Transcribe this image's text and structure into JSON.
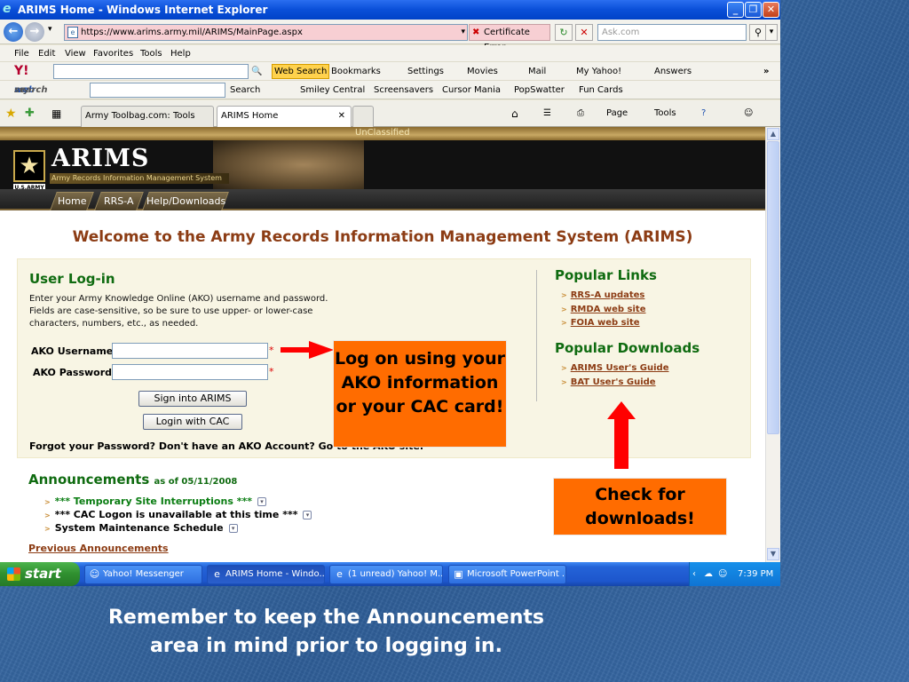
{
  "window": {
    "title": "ARIMS Home - Windows Internet Explorer",
    "address": "https://www.arims.army.mil/ARIMS/MainPage.aspx",
    "cert_error": "Certificate Error",
    "search_placeholder": "Ask.com"
  },
  "menu": [
    "File",
    "Edit",
    "View",
    "Favorites",
    "Tools",
    "Help"
  ],
  "yahoo_toolbar": {
    "web_search": "Web Search",
    "bookmarks": "Bookmarks",
    "settings": "Settings",
    "movies": "Movies",
    "mail": "Mail",
    "my_yahoo": "My Yahoo!",
    "answers": "Answers",
    "more": "»"
  },
  "mws_toolbar": {
    "logo_my": "my",
    "logo_web": "web",
    "logo_search": "search",
    "search": "Search",
    "smiley": "Smiley Central",
    "screensavers": "Screensavers",
    "cursor": "Cursor Mania",
    "popswatter": "PopSwatter",
    "funcards": "Fun Cards"
  },
  "tabs": {
    "tab1": "Army Toolbag.com: Tools for...",
    "tab2": "ARIMS Home",
    "page": "Page",
    "tools": "Tools"
  },
  "banner": {
    "classification": "UnClassified",
    "logo": "ARIMS",
    "subtitle": "Army Records Information Management System",
    "usarmy": "U.S.ARMY",
    "nav": [
      "Home",
      "RRS-A",
      "Help/Downloads"
    ]
  },
  "page": {
    "welcome": "Welcome to the Army Records Information Management System (ARIMS)",
    "login_title": "User Log-in",
    "login_desc": "Enter your Army Knowledge Online (AKO) username and password. Fields are case-sensitive, so be sure to use upper- or lower-case characters, numbers, etc., as needed.",
    "username_label": "AKO Username:",
    "password_label": "AKO Password:",
    "required_mark": "*",
    "sign_in": "Sign into ARIMS",
    "cac_login": "Login with CAC",
    "forgot": "Forgot your Password? Don't have an AKO Account?  Go to the AKO site.",
    "popular_links_title": "Popular Links",
    "popular_links": [
      "RRS-A updates",
      "RMDA web site",
      "FOIA web site"
    ],
    "popular_downloads_title": "Popular Downloads",
    "popular_downloads": [
      "ARIMS User's Guide",
      "BAT User's Guide"
    ],
    "announcements_title": "Announcements",
    "announcements_date": "as of 05/11/2008",
    "announcements": [
      "*** Temporary Site Interruptions ***",
      "*** CAC Logon is unavailable at this time ***",
      "System Maintenance Schedule"
    ],
    "previous": "Previous Announcements"
  },
  "callouts": {
    "login": "Log on using your AKO information or your CAC card!",
    "downloads": "Check for downloads!"
  },
  "taskbar": {
    "start": "start",
    "tasks": [
      "Yahoo! Messenger",
      "ARIMS Home - Windo...",
      "(1 unread) Yahoo! M...",
      "Microsoft PowerPoint ..."
    ],
    "time": "7:39 PM"
  },
  "caption": "Remember to keep the Announcements area in mind prior to logging in.",
  "colors": {
    "callout": "#ff6c00",
    "arrow": "#ff0000",
    "heading_green": "#0f6b10",
    "welcome_brown": "#8c3c14"
  }
}
